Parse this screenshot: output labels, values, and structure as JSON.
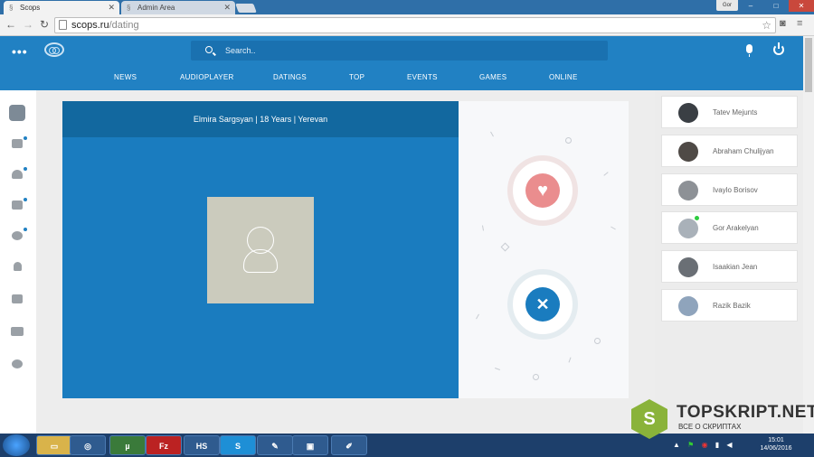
{
  "browser": {
    "tabs": [
      {
        "title": "Scops",
        "active": true
      },
      {
        "title": "Admin Area",
        "active": false
      }
    ],
    "user_badge": "Gor",
    "url_host": "scops.ru",
    "url_path": "/dating"
  },
  "header": {
    "search_placeholder": "Search..",
    "nav": [
      "NEWS",
      "AUDIOPLAYER",
      "DATINGS",
      "TOP",
      "EVENTS",
      "GAMES",
      "ONLINE"
    ]
  },
  "dating": {
    "profile_title": "Elmira Sargsyan | 18 Years | Yerevan"
  },
  "online_users": [
    {
      "name": "Tatev Mejunts",
      "online": false
    },
    {
      "name": "Abraham Chulijyan",
      "online": false
    },
    {
      "name": "Ivaylo Borisov",
      "online": false
    },
    {
      "name": "Gor Arakelyan",
      "online": true
    },
    {
      "name": "Isaakian Jean",
      "online": false
    },
    {
      "name": "Razik Bazik",
      "online": false
    }
  ],
  "taskbar": {
    "time": "15:01",
    "date": "14/06/2016"
  },
  "watermark": {
    "logo_letter": "S",
    "title": "TOPSKRIPT.NET",
    "subtitle": "ВСЕ О СКРИПТАХ"
  },
  "colors": {
    "brand": "#2181c3",
    "like": "#ea8d8e",
    "dislike": "#1a7cbf"
  }
}
